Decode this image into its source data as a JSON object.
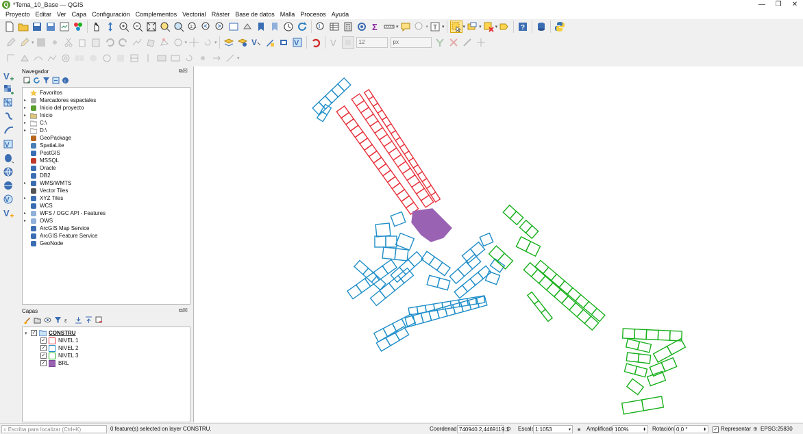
{
  "window": {
    "title": "*Tema_10_Base — QGIS",
    "minimize": "—",
    "maximize": "❐",
    "close": "✕"
  },
  "menu": [
    "Proyecto",
    "Editar",
    "Ver",
    "Capa",
    "Configuración",
    "Complementos",
    "Vectorial",
    "Ráster",
    "Base de datos",
    "Malla",
    "Procesos",
    "Ayuda"
  ],
  "toolbar": {
    "font_size": "12",
    "font_unit": "px"
  },
  "navigator": {
    "title": "Navegador",
    "items": [
      {
        "label": "Favoritos",
        "arrow": "",
        "icon": "star-icon"
      },
      {
        "label": "Marcadores espaciales",
        "arrow": "▸",
        "icon": "bookmarks-icon"
      },
      {
        "label": "Inicio del proyecto",
        "arrow": "▸",
        "icon": "project-home-icon"
      },
      {
        "label": "Inicio",
        "arrow": "▸",
        "icon": "home-folder-icon"
      },
      {
        "label": "C:\\",
        "arrow": "▸",
        "icon": "drive-icon"
      },
      {
        "label": "D:\\",
        "arrow": "▸",
        "icon": "drive-icon"
      },
      {
        "label": "GeoPackage",
        "arrow": "",
        "icon": "geopackage-icon"
      },
      {
        "label": "SpatiaLite",
        "arrow": "",
        "icon": "spatialite-icon"
      },
      {
        "label": "PostGIS",
        "arrow": "",
        "icon": "postgis-icon"
      },
      {
        "label": "MSSQL",
        "arrow": "",
        "icon": "mssql-icon"
      },
      {
        "label": "Oracle",
        "arrow": "",
        "icon": "oracle-icon"
      },
      {
        "label": "DB2",
        "arrow": "",
        "icon": "db2-icon"
      },
      {
        "label": "WMS/WMTS",
        "arrow": "▸",
        "icon": "wms-icon"
      },
      {
        "label": "Vector Tiles",
        "arrow": "",
        "icon": "vector-tiles-icon"
      },
      {
        "label": "XYZ Tiles",
        "arrow": "▸",
        "icon": "xyz-tiles-icon"
      },
      {
        "label": "WCS",
        "arrow": "",
        "icon": "wcs-icon"
      },
      {
        "label": "WFS / OGC API - Features",
        "arrow": "▸",
        "icon": "wfs-icon"
      },
      {
        "label": "OWS",
        "arrow": "▸",
        "icon": "ows-icon"
      },
      {
        "label": "ArcGIS Map Service",
        "arrow": "",
        "icon": "arcgis-map-icon"
      },
      {
        "label": "ArcGIS Feature Service",
        "arrow": "",
        "icon": "arcgis-feature-icon"
      },
      {
        "label": "GeoNode",
        "arrow": "",
        "icon": "geonode-icon"
      }
    ]
  },
  "layers": {
    "title": "Capas",
    "group": {
      "label": "CONSTRU",
      "arrow": "▾",
      "checked": "✓"
    },
    "items": [
      {
        "label": "NIVEL 1",
        "color": "#e8313b",
        "fill": "none",
        "checked": "✓"
      },
      {
        "label": "NIVEL 2",
        "color": "#1f8ec9",
        "fill": "none",
        "checked": "✓"
      },
      {
        "label": "NIVEL 3",
        "color": "#17b01b",
        "fill": "none",
        "checked": "✓"
      },
      {
        "label": "BRL",
        "color": "#9a62b3",
        "fill": "#9a62b3",
        "checked": "✓"
      }
    ]
  },
  "status": {
    "locator_placeholder": "Escriba para localizar (Ctrl+K)",
    "message": "0 feature(s) selected on layer CONSTRU.",
    "coord_label": "Coordenada",
    "coord_value": "740940.2,4469119.1",
    "scale_label": "Escala",
    "scale_value": "1:1053",
    "magnifier_label": "Amplificador",
    "magnifier_value": "100%",
    "rotation_label": "Rotación",
    "rotation_value": "0,0 °",
    "render_label": "Representar",
    "render_checked": "✓",
    "crs": "EPSG:25830"
  },
  "colors": {
    "nivel1": "#e8313b",
    "nivel2": "#1f8ec9",
    "nivel3": "#17b01b",
    "brl": "#9a62b3"
  }
}
